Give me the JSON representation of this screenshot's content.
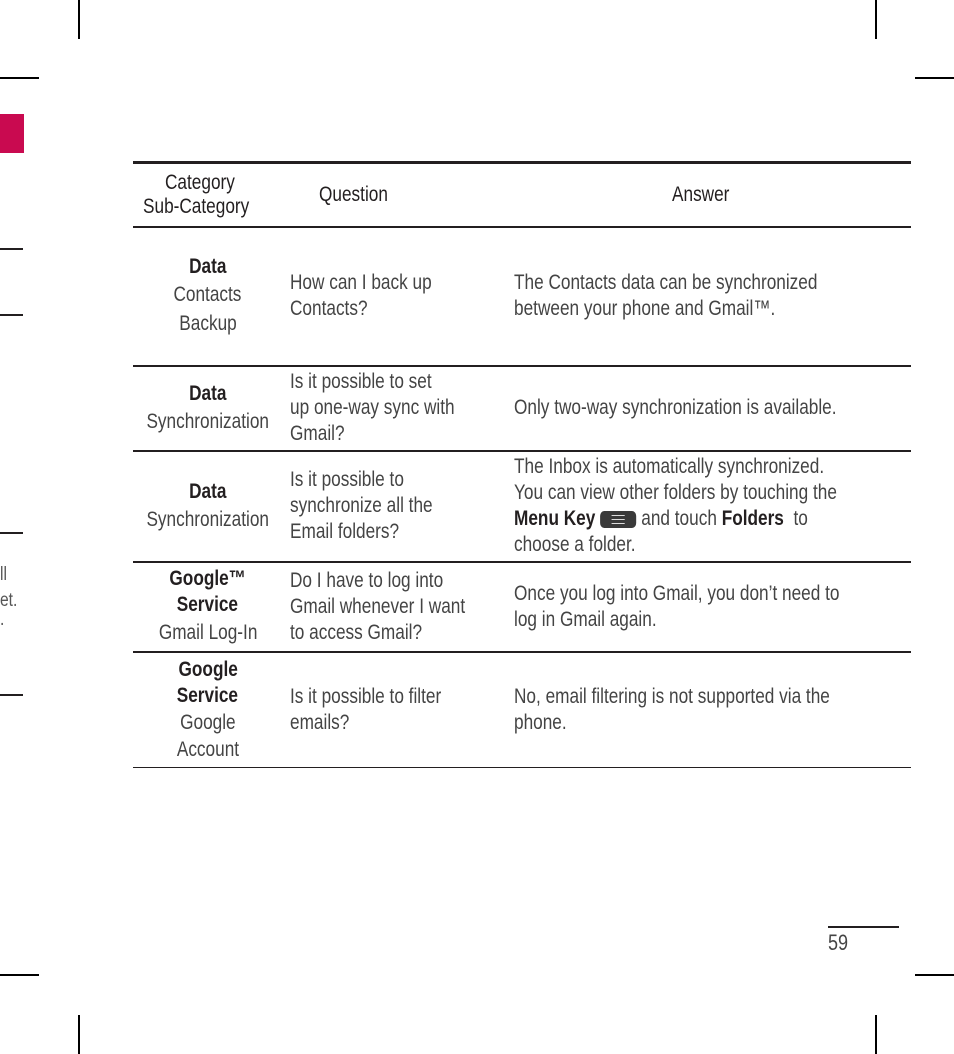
{
  "table": {
    "headers": {
      "category_line1": "Category",
      "category_line2": "Sub-Category",
      "question": "Question",
      "answer": "Answer"
    },
    "rows": [
      {
        "category_lines": [
          "Data"
        ],
        "subcategory_lines": [
          "Contacts",
          "Backup"
        ],
        "question_lines": [
          "How can I back up",
          "Contacts?"
        ],
        "answer_lines": [
          "The Contacts data can be synchronized",
          "between your phone and Gmail™."
        ]
      },
      {
        "category_lines": [
          "Data"
        ],
        "subcategory_lines": [
          "Synchronization"
        ],
        "question_lines": [
          "Is it possible to set",
          "up one-way sync with",
          "Gmail?"
        ],
        "answer_lines": [
          "Only two-way synchronization is available."
        ]
      },
      {
        "category_lines": [
          "Data"
        ],
        "subcategory_lines": [
          "Synchronization"
        ],
        "question_lines": [
          "Is it possible to",
          "synchronize all the",
          "Email folders?"
        ],
        "answer": {
          "line1": "The Inbox is automatically synchronized.",
          "line2": "You can view other folders by touching the",
          "menu_key_label": "Menu Key",
          "menu_key_icon": "menu-key-icon",
          "and_touch": "and touch",
          "folders_label": "Folders",
          "to": "to",
          "line4": "choose a folder."
        }
      },
      {
        "category_lines": [
          "Google™",
          "Service"
        ],
        "subcategory_lines": [
          "Gmail Log-In"
        ],
        "question_lines": [
          "Do I have to log into",
          "Gmail whenever I want",
          "to access Gmail?"
        ],
        "answer_lines": [
          "Once you log into Gmail, you don’t need to",
          "log in Gmail again."
        ]
      },
      {
        "category_lines": [
          "Google",
          "Service"
        ],
        "subcategory_lines": [
          "Google",
          "Account"
        ],
        "question_lines": [
          "Is it possible to filter",
          "emails?"
        ],
        "answer_lines": [
          "No, email filtering is not supported via the",
          "phone."
        ]
      }
    ]
  },
  "edge_fragments": [
    "ll",
    "et.",
    "."
  ],
  "page_number": "59",
  "colors": {
    "accent_tab": "#c90a50",
    "text": "#231f20"
  }
}
